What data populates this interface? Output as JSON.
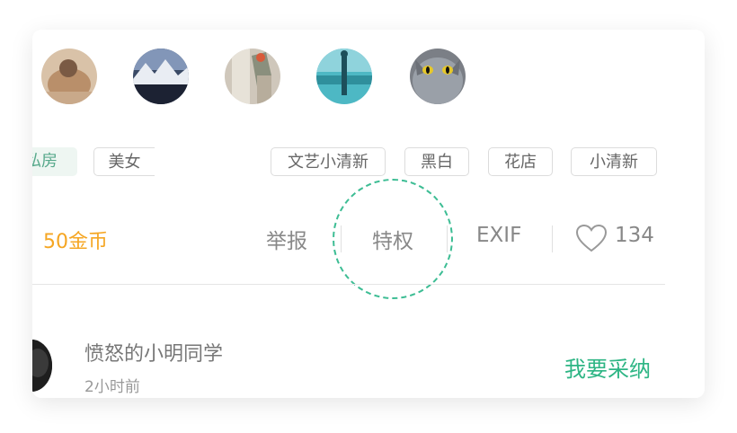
{
  "avatars": [
    {
      "name": "avatar-1"
    },
    {
      "name": "avatar-2"
    },
    {
      "name": "avatar-3"
    },
    {
      "name": "avatar-4"
    },
    {
      "name": "avatar-5"
    }
  ],
  "tags": {
    "left": [
      "私房",
      "美女"
    ],
    "right": [
      "文艺小清新",
      "黑白",
      "花店",
      "小清新"
    ]
  },
  "actions": {
    "coins": "50金币",
    "report": "举报",
    "privilege": "特权",
    "exif": "EXIF",
    "likes": "134"
  },
  "comment": {
    "username": "愤怒的小明同学",
    "time": "2小时前",
    "adopt_label": "我要采纳"
  },
  "colors": {
    "accent_green": "#2db584",
    "coin_orange": "#f5a623",
    "dashed_highlight": "#3dbd94"
  },
  "icons": {
    "like": "heart-icon"
  }
}
